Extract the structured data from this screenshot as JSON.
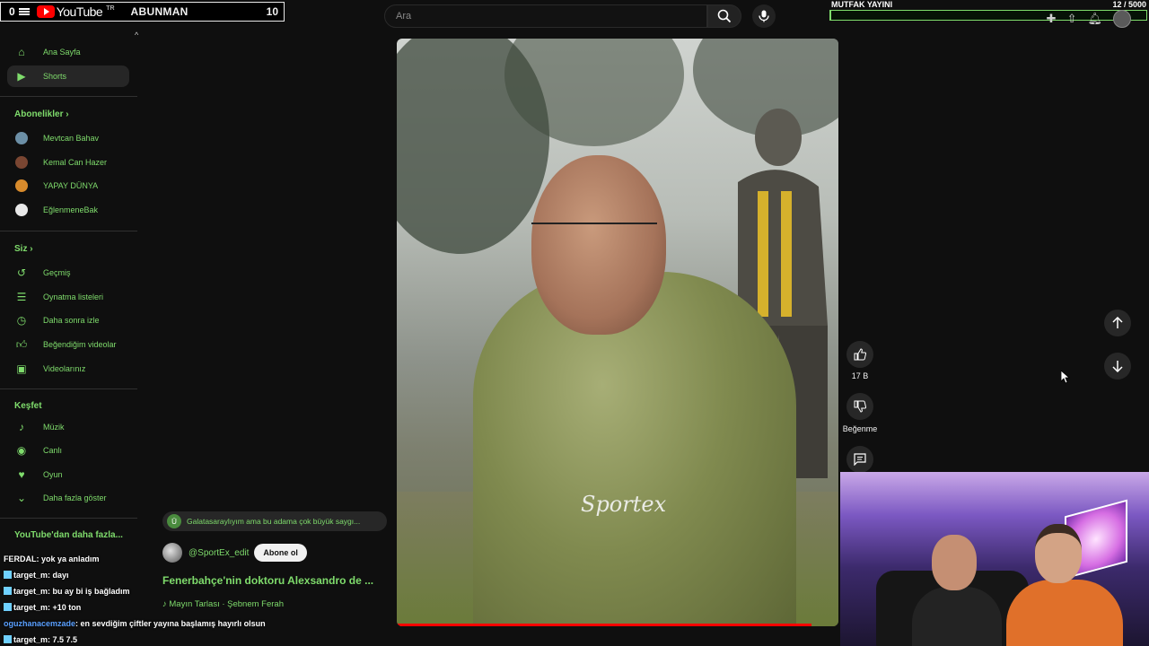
{
  "overlay": {
    "counter_left": "0",
    "youtube_word": "YouTube",
    "youtube_region": "TR",
    "follower_label": "ABUNMAN",
    "follower_count": "10",
    "goal_title": "MUTFAK YAYINI",
    "goal_count": "12 / 5000",
    "goal_fraction": 0.0024
  },
  "search": {
    "placeholder": "Ara"
  },
  "sidebar": {
    "main": [
      {
        "label": "Ana Sayfa",
        "icon": "home-icon"
      },
      {
        "label": "Shorts",
        "icon": "shorts-icon"
      }
    ],
    "subscriptions_title": "Abonelikler",
    "subscriptions": [
      {
        "label": "Mevtcan Bahav",
        "color": "#6c8fa6"
      },
      {
        "label": "Kemal Can Hazer",
        "color": "#7a4632"
      },
      {
        "label": "YAPAY DÜNYA",
        "color": "#d88b2c"
      },
      {
        "label": "EğlenmeneBak",
        "color": "#e8e8e8"
      }
    ],
    "you_title": "Siz",
    "you": [
      {
        "label": "Geçmiş",
        "icon": "history-icon"
      },
      {
        "label": "Oynatma listeleri",
        "icon": "playlist-icon"
      },
      {
        "label": "Daha sonra izle",
        "icon": "clock-icon"
      },
      {
        "label": "Beğendiğim videolar",
        "icon": "thumb-up-icon"
      },
      {
        "label": "Videolarınız",
        "icon": "video-icon"
      }
    ],
    "explore_title": "Keşfet",
    "explore": [
      {
        "label": "Müzik",
        "icon": "music-icon"
      },
      {
        "label": "Canlı",
        "icon": "live-icon"
      },
      {
        "label": "Oyun",
        "icon": "gaming-icon"
      },
      {
        "label": "Daha fazla göster",
        "icon": "chevron-down-icon"
      }
    ],
    "more_title": "YouTube'dan daha fazla..."
  },
  "chat": [
    {
      "user": "FERDAL",
      "text": ": yok ya anladım",
      "cls": "u-grey",
      "icon": false
    },
    {
      "user": "target_m",
      "text": ": dayı",
      "cls": "u-cyan",
      "icon": true
    },
    {
      "user": "target_m",
      "text": ": bu ay bi iş bağladım",
      "cls": "u-cyan",
      "icon": true
    },
    {
      "user": "target_m",
      "text": ": +10 ton",
      "cls": "u-cyan",
      "icon": true
    },
    {
      "user": "oguzhanacemzade",
      "text": ": en sevdiğim çiftler yayına başlamış hayırlı olsun",
      "cls": "u-blue",
      "icon": false
    },
    {
      "user": "target_m",
      "text": ": 7.5 7.5",
      "cls": "u-cyan",
      "icon": true
    }
  ],
  "short": {
    "comment_badge": "Ü",
    "comment": "Galatasaraylıyım ama bu adama çok büyük saygı...",
    "channel": "@SportEx_edit",
    "subscribe_label": "Abone ol",
    "title": "Fenerbahçe'nin doktoru Alexsandro de ...",
    "music": "♪ Mayın Tarlası · Şebnem Ferah",
    "watermark": "Sportex",
    "progress_fraction": 0.94
  },
  "actions": {
    "like_count": "17 B",
    "dislike_label": "Beğenme"
  },
  "colors": {
    "accent": "#7fdc6c",
    "progress": "#ff0000"
  }
}
